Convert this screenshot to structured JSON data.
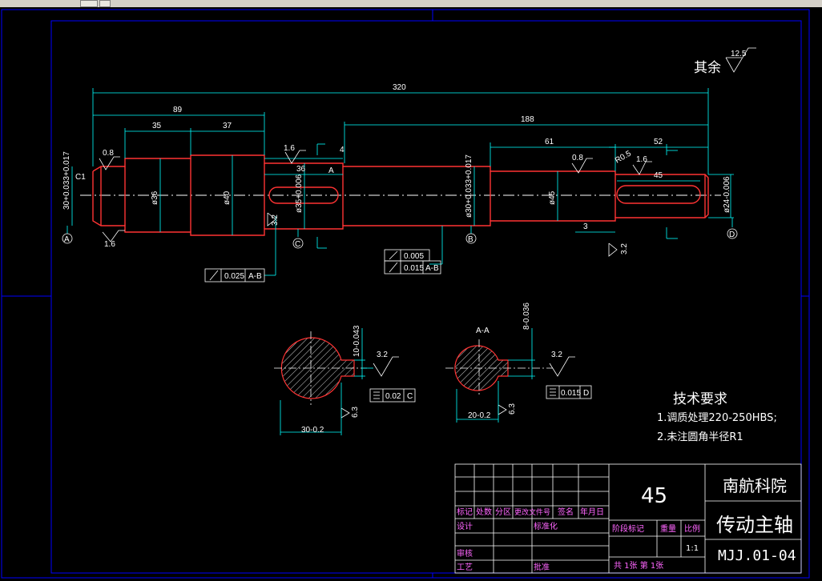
{
  "colors": {
    "background": "#000000",
    "frame": "#0000ff",
    "part": "#ff0000",
    "dim": "#00ffff",
    "text": "#ffffff",
    "title": "#ff00ff"
  },
  "surface_note": {
    "label": "其余",
    "ra": "12.5"
  },
  "dims": {
    "total": "320",
    "d89": "89",
    "d35": "35",
    "d37": "37",
    "d188": "188",
    "d61": "61",
    "d52": "52",
    "d45": "45",
    "d36": "36",
    "d4": "4",
    "d3": "3",
    "c1": "C1",
    "r0_5": "R0.5",
    "dia36": "ø36",
    "dia40": "ø40",
    "dia35": "ø35+0.006",
    "dia30": "ø30+0.033+0.017",
    "dia30left": "30+0.033+0.017",
    "dia45": "ø45",
    "dia24": "ø24-0.006",
    "ra08a": "0.8",
    "ra16a": "1.6",
    "ra16b": "1.6",
    "ra08b": "0.8",
    "ra16c": "1.6",
    "ra32a": "3.2",
    "ra32b": "3.2",
    "ra32c": "3.2",
    "ra32d": "3.2",
    "ra63a": "6.3",
    "ra63b": "6.3",
    "sec1_key": "10-0.043",
    "sec1_w": "30-0.2",
    "sec2_key": "8-0.036",
    "sec2_w": "20-0.2",
    "sec2_label": "A-A",
    "sec_a": "A"
  },
  "datums": {
    "a": "A",
    "b": "B",
    "c": "C",
    "d": "D"
  },
  "gdt": {
    "runout1": {
      "value": "0.025",
      "datum": "A-B"
    },
    "cyl": {
      "value": "0.005"
    },
    "runout2": {
      "value": "0.015",
      "datum": "A-B"
    },
    "sym1": {
      "value": "0.02",
      "datum": "C"
    },
    "sym2": {
      "value": "0.015",
      "datum": "D"
    }
  },
  "tech_req": {
    "title": "技术要求",
    "line1": "1.调质处理220-250HBS;",
    "line2": "2.未注圆角半径R1"
  },
  "title_block": {
    "material": "45",
    "company": "南航科院",
    "part_name": "传动主轴",
    "drawing_no": "MJJ.01-04",
    "scale": "1:1",
    "h_mark": "标记",
    "h_count": "处数",
    "h_zone": "分区",
    "h_doc": "更改文件号",
    "h_sign": "签名",
    "h_date": "年月日",
    "design": "设计",
    "standard": "标准化",
    "review": "审核",
    "process": "工艺",
    "approve": "批准",
    "stage": "阶段标记",
    "weight": "重量",
    "ratio": "比例",
    "sheets": "共 1张 第 1张"
  }
}
